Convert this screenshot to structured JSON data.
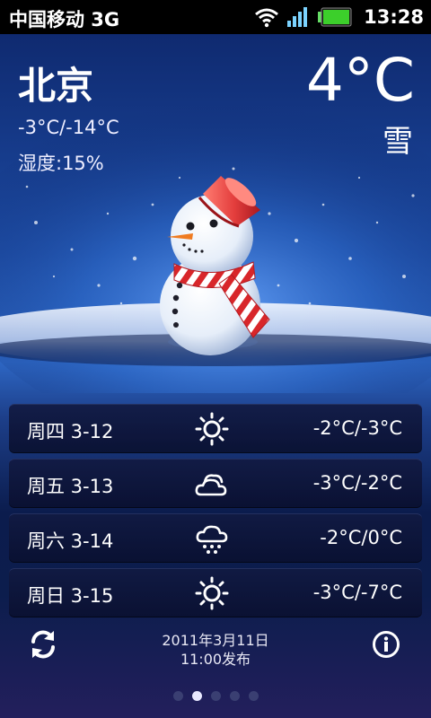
{
  "status_bar": {
    "carrier": "中国移动 3G",
    "time": "13:28",
    "icons": [
      "wifi-icon",
      "signal-icon",
      "battery-icon"
    ]
  },
  "current": {
    "city": "北京",
    "temperature": "4°C",
    "condition": "雪",
    "range": "-3°C/-14°C",
    "humidity": "湿度:15%",
    "illustration": "snowman"
  },
  "forecast": [
    {
      "day": "周四 3-12",
      "icon": "sunny-icon",
      "range": "-2°C/-3°C"
    },
    {
      "day": "周五 3-13",
      "icon": "cloudy-icon",
      "range": "-3°C/-2°C"
    },
    {
      "day": "周六 3-14",
      "icon": "snow-icon",
      "range": "-2°C/0°C"
    },
    {
      "day": "周日 3-15",
      "icon": "sunny-icon",
      "range": "-3°C/-7°C"
    }
  ],
  "footer": {
    "published_line1": "2011年3月11日",
    "published_line2": "11:00发布",
    "refresh_icon": "refresh-icon",
    "info_icon": "info-icon"
  },
  "pager": {
    "count": 5,
    "active_index": 1
  },
  "colors": {
    "accent": "#2d66c3",
    "scarf_red": "#d8262a",
    "bucket_red": "#e8413f"
  }
}
